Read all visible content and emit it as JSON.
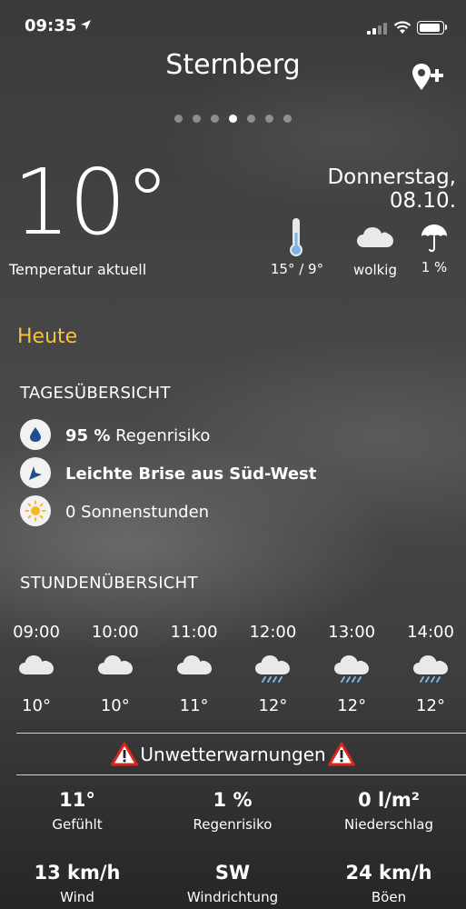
{
  "status_bar": {
    "time": "09:35"
  },
  "header": {
    "city": "Sternberg",
    "page_count": 7,
    "active_page": 4
  },
  "current": {
    "temperature": "10°",
    "temperature_label": "Temperatur aktuell",
    "date": "Donnerstag, 08.10.",
    "summary": {
      "minmax": "15° / 9°",
      "condition": "wolkig",
      "rain_chance": "1 %"
    }
  },
  "today_label": "Heute",
  "day_overview": {
    "title": "TAGESÜBERSICHT",
    "rain": {
      "value": "95 %",
      "text": "Regenrisiko"
    },
    "wind": "Leichte Brise aus Süd-West",
    "sun": "0 Sonnenstunden"
  },
  "hourly": {
    "title": "STUNDENÜBERSICHT",
    "hours": [
      {
        "time": "09:00",
        "icon": "cloud-icon",
        "temp": "10°"
      },
      {
        "time": "10:00",
        "icon": "cloud-icon",
        "temp": "10°"
      },
      {
        "time": "11:00",
        "icon": "cloud-icon",
        "temp": "11°"
      },
      {
        "time": "12:00",
        "icon": "cloud-rain-icon",
        "temp": "12°"
      },
      {
        "time": "13:00",
        "icon": "cloud-rain-icon",
        "temp": "12°"
      },
      {
        "time": "14:00",
        "icon": "cloud-rain-icon",
        "temp": "12°"
      }
    ]
  },
  "warnings": {
    "label": "Unwetterwarnungen"
  },
  "details": [
    {
      "value": "11°",
      "label": "Gefühlt"
    },
    {
      "value": "1 %",
      "label": "Regenrisiko"
    },
    {
      "value": "0 l/m²",
      "label": "Niederschlag"
    },
    {
      "value": "13 km/h",
      "label": "Wind"
    },
    {
      "value": "SW",
      "label": "Windrichtung"
    },
    {
      "value": "24 km/h",
      "label": "Böen"
    }
  ],
  "colors": {
    "accent": "#f5c242",
    "rain_drop": "#1f4e8c",
    "sun": "#f5b820",
    "warning": "#d9241c"
  }
}
